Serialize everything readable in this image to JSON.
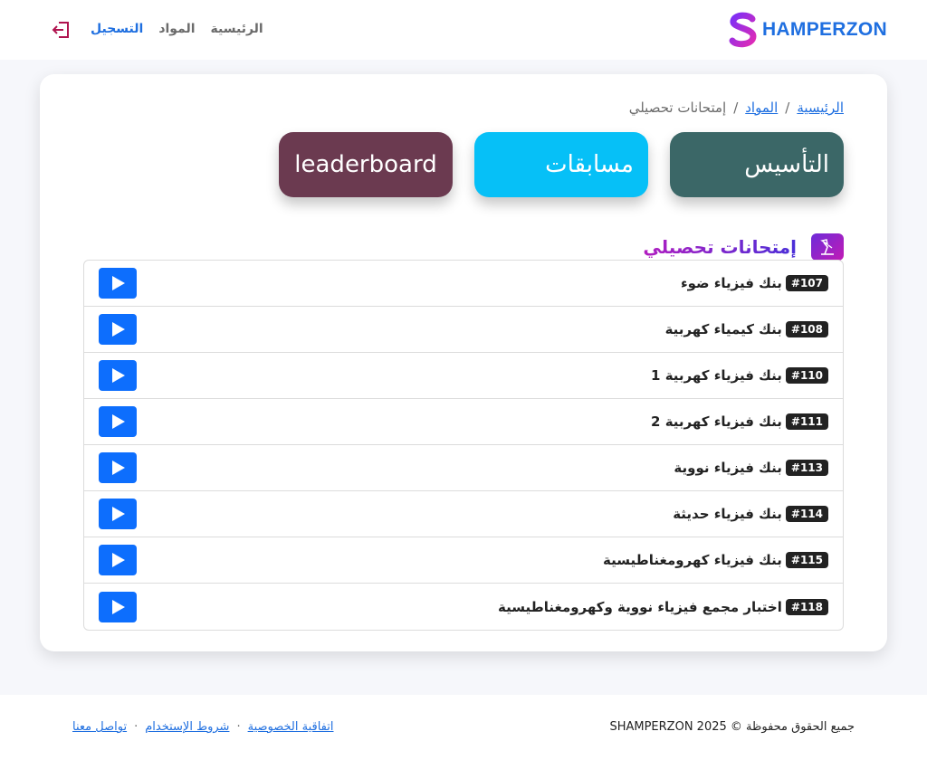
{
  "navbar": {
    "brand": "HAMPERZON",
    "links": [
      {
        "label": "الرئيسية",
        "active": false
      },
      {
        "label": "المواد",
        "active": false
      },
      {
        "label": "التسجيل",
        "active": true
      }
    ],
    "logout_icon": "logout-icon"
  },
  "breadcrumb": {
    "home": "الرئيسية",
    "subjects": "المواد",
    "current": "إمتحانات تحصيلي",
    "separator": "/"
  },
  "tiles": [
    {
      "label": "التأسيس",
      "color": "#3b6767"
    },
    {
      "label": "مسابقات",
      "color": "#06c0f7"
    },
    {
      "label": "leaderboard",
      "color": "#6b3a50"
    }
  ],
  "section": {
    "title": "إمتحانات تحصيلي",
    "icon": "lamp-icon"
  },
  "exams": [
    {
      "badge": "#107",
      "title": "بنك فيزياء ضوء"
    },
    {
      "badge": "#108",
      "title": "بنك كيمياء كهربية"
    },
    {
      "badge": "#110",
      "title": "بنك فيزياء كهربية 1"
    },
    {
      "badge": "#111",
      "title": "بنك فيزياء كهربية 2"
    },
    {
      "badge": "#113",
      "title": "بنك فيزياء نووية"
    },
    {
      "badge": "#114",
      "title": "بنك فيزياء حديثة"
    },
    {
      "badge": "#115",
      "title": "بنك فيزياء كهرومغناطيسية"
    },
    {
      "badge": "#118",
      "title": "اختبار مجمع فيزياء نووية وكهرومغناطيسية"
    }
  ],
  "footer": {
    "copyright": "جميع الحقوق محفوظة © SHAMPERZON 2025",
    "links": [
      "اتفاقية الخصوصية",
      "شروط الإستخدام",
      "تواصل معنا"
    ],
    "separator": "·"
  },
  "colors": {
    "accent": "#1f6fe0",
    "play_button": "#0d6efd",
    "badge": "#222222"
  }
}
